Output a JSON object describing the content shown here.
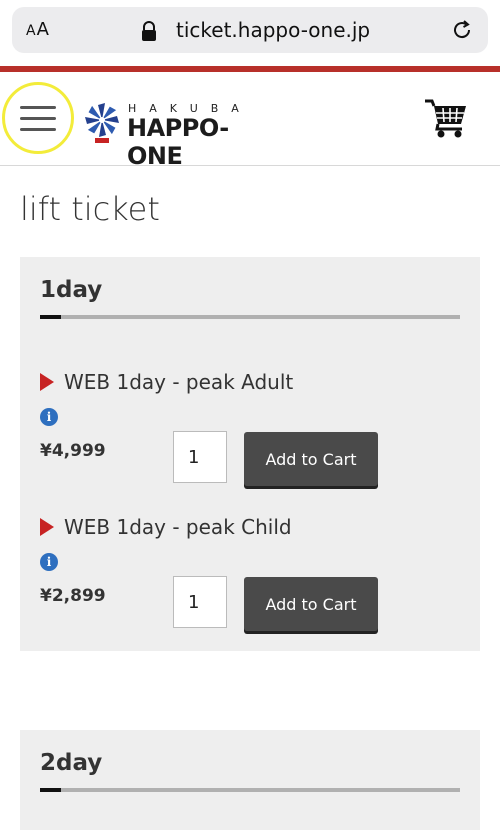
{
  "browser": {
    "text_size_label_small": "A",
    "text_size_label_large": "A",
    "url": "ticket.happo-one.jp"
  },
  "header": {
    "logo_top": "HAKUBA",
    "logo_main": "HAPPO-ONE",
    "accent_color": "#b8302a"
  },
  "page": {
    "title": "lift ticket"
  },
  "sections": [
    {
      "title": "1day",
      "progress": 0.05,
      "items": [
        {
          "name": "WEB 1day - peak Adult",
          "price": "¥4,999",
          "qty": "1",
          "button": "Add to Cart"
        },
        {
          "name": "WEB 1day - peak Child",
          "price": "¥2,899",
          "qty": "1",
          "button": "Add to Cart"
        }
      ]
    },
    {
      "title": "2day",
      "progress": 0.05
    }
  ],
  "icons": {
    "menu": "hamburger-menu-icon",
    "cart": "shopping-cart-icon",
    "info": "info-icon",
    "info_glyph": "i",
    "lock": "lock-icon",
    "reload": "reload-icon"
  }
}
